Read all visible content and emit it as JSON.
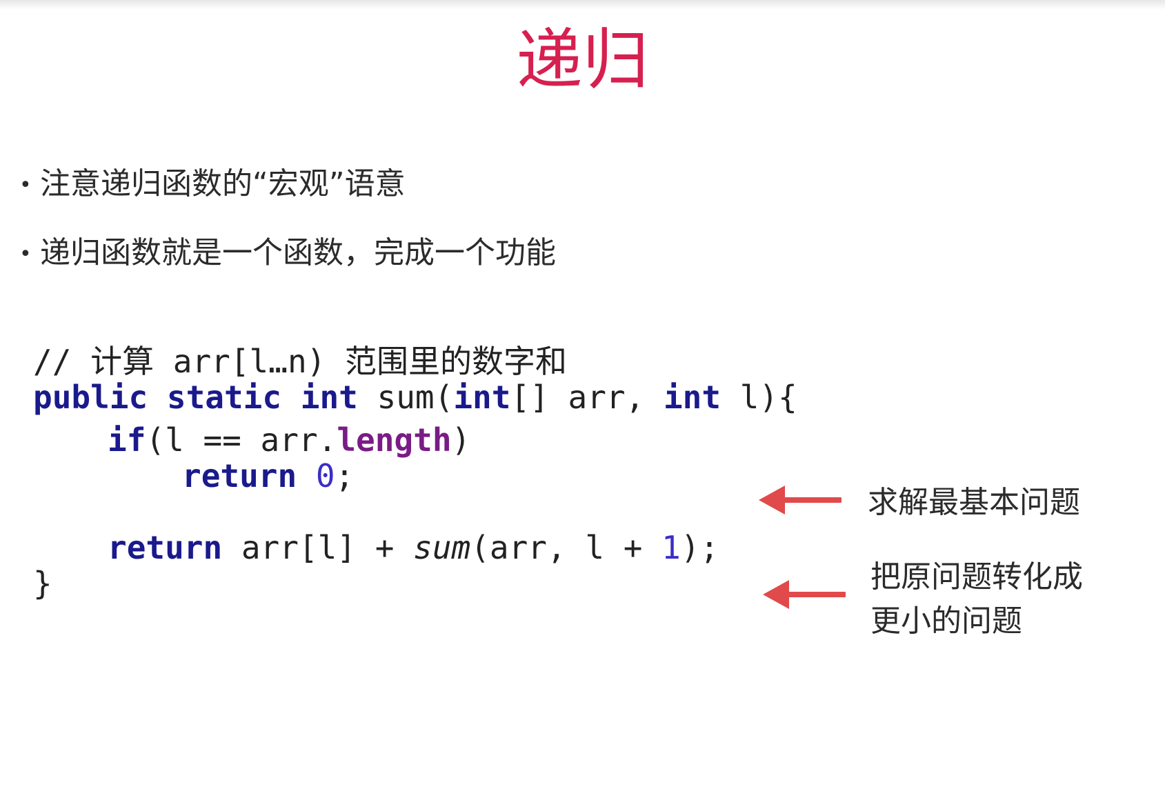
{
  "slide": {
    "title": "递归",
    "bullets": [
      "注意递归函数的“宏观”语意",
      "递归函数就是一个函数，完成一个功能"
    ]
  },
  "code": {
    "comment": "// 计算 arr[l…n) 范围里的数字和",
    "signature": {
      "kw_public": "public",
      "kw_static": "static",
      "kw_int": "int",
      "name": "sum(",
      "param_type": "int",
      "param_rest": "[] arr, ",
      "param_type2": "int",
      "param_tail": " l){"
    },
    "if_line": {
      "kw_if": "if",
      "cond_start": "(l == arr.",
      "field": "length",
      "cond_end": ")"
    },
    "return_base": {
      "kw_return": "return",
      "value": "0",
      "end": ";"
    },
    "return_rec": {
      "kw_return": "return",
      "expr_start": " arr[l] + ",
      "call": "sum",
      "args_start": "(arr, l + ",
      "num": "1",
      "args_end": ");"
    },
    "closing": "}"
  },
  "annotations": {
    "base_case": "求解最基本问题",
    "reduce_line1": "把原问题转化成",
    "reduce_line2": "更小的问题"
  },
  "colors": {
    "title": "#d6204f",
    "keyword": "#1a1a8c",
    "field": "#7a1b86",
    "number": "#3b2ec8",
    "arrow": "#e04a4a"
  }
}
